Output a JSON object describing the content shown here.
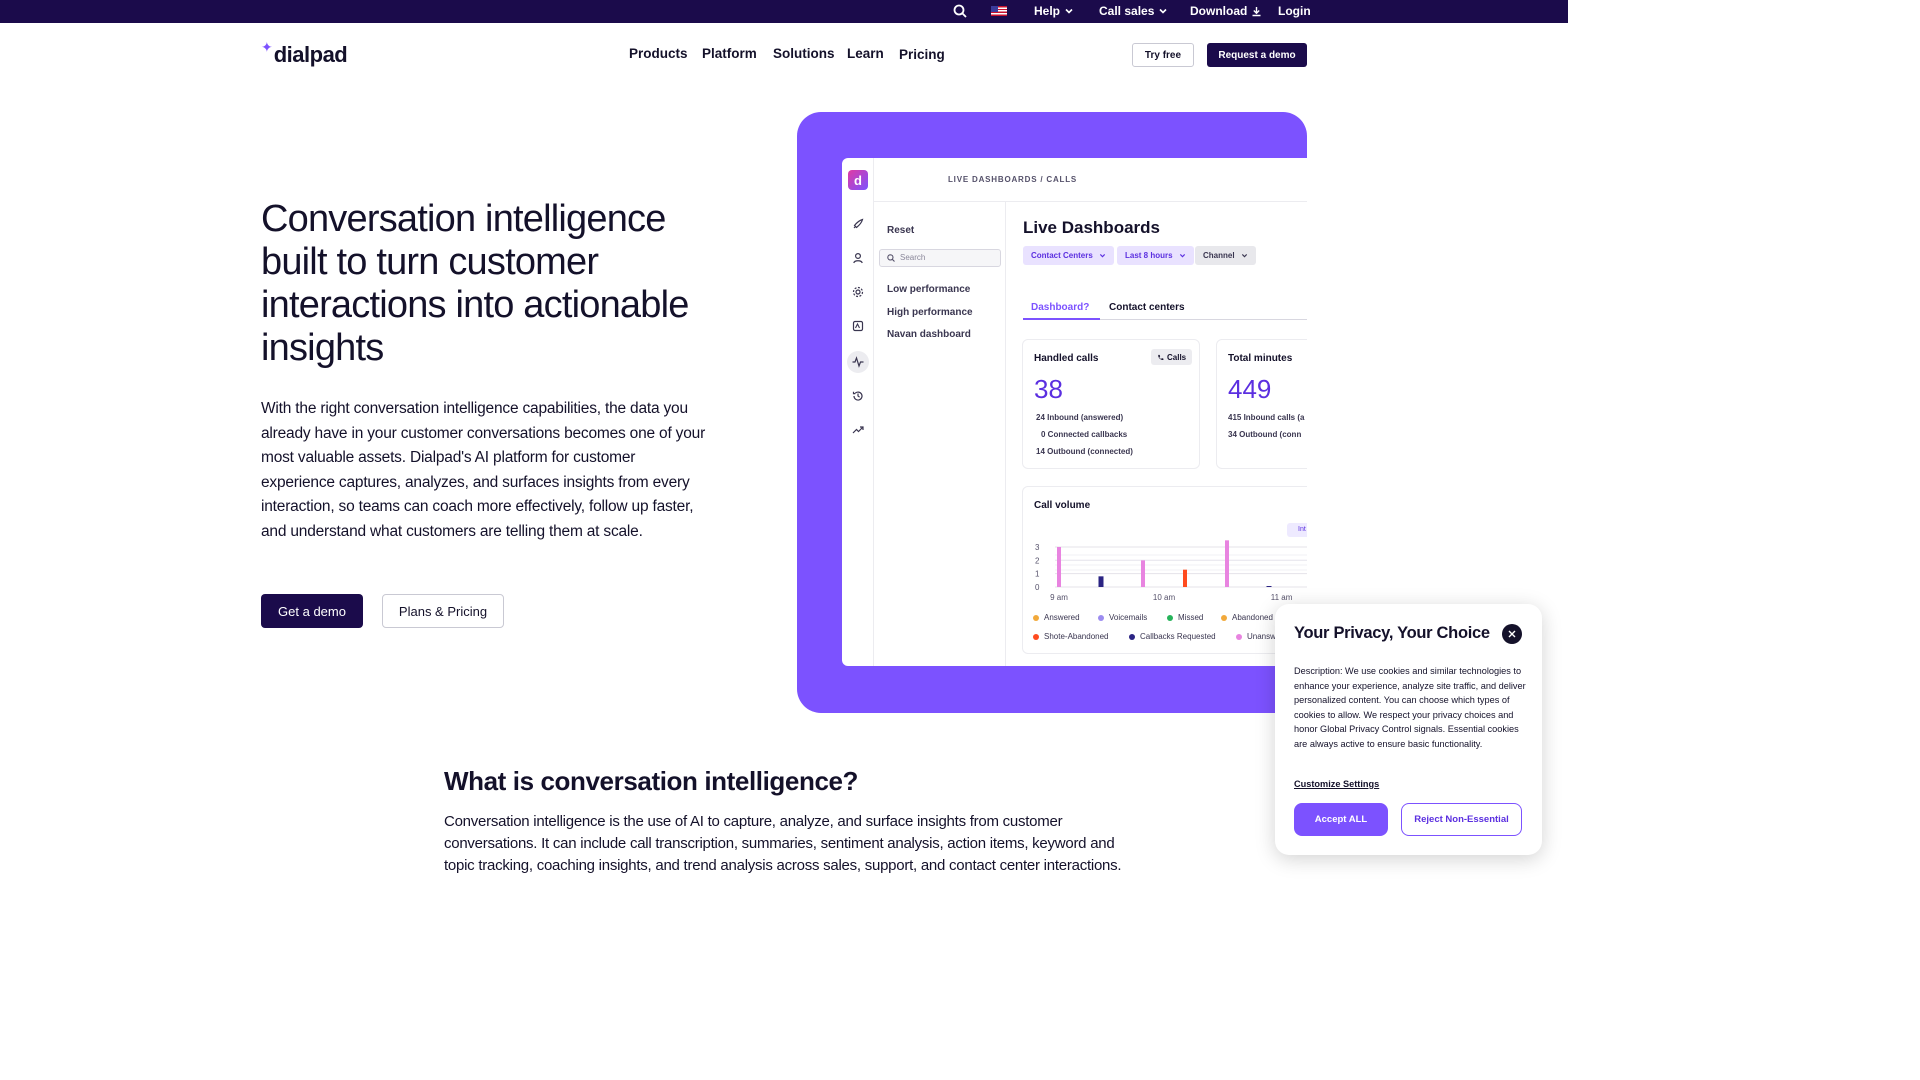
{
  "topbar": {
    "search_icon": "search-icon",
    "flag_icon": "us-flag-icon",
    "help": "Help",
    "call_sales": "Call sales",
    "download": "Download",
    "login": "Login"
  },
  "nav": {
    "logo": "dialpad",
    "items": [
      "Products",
      "Platform",
      "Solutions",
      "Learn",
      "Pricing"
    ],
    "try_free": "Try free",
    "request_demo": "Request a demo"
  },
  "hero": {
    "title": "Conversation intelligence built to turn customer interactions into actionable insights",
    "body": "With the right conversation intelligence capabilities, the data you already have in your customer conversations becomes one of your most valuable assets. Dialpad's AI platform for customer experience captures, analyzes, and surfaces insights from every interaction, so teams can coach more effectively, follow up faster, and understand what customers are telling them at scale.",
    "get_demo": "Get a demo",
    "plans_pricing": "Plans & Pricing"
  },
  "app": {
    "logo_letter": "d",
    "breadcrumb": "LIVE DASHBOARDS / CALLS",
    "panel": {
      "reset": "Reset",
      "search_placeholder": "Search",
      "items": [
        "Low performance",
        "High performance",
        "Navan dashboard"
      ]
    },
    "title": "Live Dashboards",
    "filters": [
      "Contact Centers",
      "Last 8 hours",
      "Channel"
    ],
    "tabs": [
      "Dashboard?",
      "Contact centers"
    ],
    "handled": {
      "title": "Handled calls",
      "chip": "Calls",
      "value": "38",
      "lines": [
        "24 Inbound (answered)",
        "0 Connected callbacks",
        "14 Outbound (connected)"
      ]
    },
    "minutes": {
      "title": "Total minutes",
      "value": "449",
      "lines": [
        "415 Inbound calls (a",
        "34 Outbound (conn"
      ]
    },
    "volume": {
      "title": "Call volume",
      "badge": "Int"
    }
  },
  "chart_data": {
    "type": "bar",
    "title": "Call volume",
    "x_ticks": [
      "9 am",
      "10 am",
      "11 am"
    ],
    "y_ticks": [
      "0",
      "1",
      "2",
      "3"
    ],
    "ylim": [
      0,
      3
    ],
    "bars": [
      {
        "x": 0.0,
        "value": 3.0,
        "series": "Unanswered"
      },
      {
        "x": 1.0,
        "value": 0.8,
        "series": "Callbacks Requested"
      },
      {
        "x": 2.0,
        "value": 2.0,
        "series": "Unanswered"
      },
      {
        "x": 3.0,
        "value": 1.3,
        "series": "Shote-Abandoned"
      },
      {
        "x": 4.0,
        "value": 3.5,
        "series": "Unanswered"
      },
      {
        "x": 5.0,
        "value": 0.05,
        "series": "Callbacks Requested"
      }
    ],
    "legend": [
      {
        "name": "Answered",
        "color": "#f2a93b"
      },
      {
        "name": "Voicemails",
        "color": "#9c8cf0"
      },
      {
        "name": "Missed",
        "color": "#26b35a"
      },
      {
        "name": "Abandoned",
        "color": "#f2a93b"
      },
      {
        "name": "Shote-Abandoned",
        "color": "#ff4b1f"
      },
      {
        "name": "Callbacks Requested",
        "color": "#2b2483"
      },
      {
        "name": "Unansw",
        "color": "#e884e0"
      }
    ],
    "colors": {
      "Unanswered": "#e884e0",
      "Callbacks Requested": "#2b2483",
      "Shote-Abandoned": "#ff4b1f"
    }
  },
  "what": {
    "heading": "What is conversation intelligence?",
    "body": "Conversation intelligence is the use of AI to capture, analyze, and surface insights from customer conversations. It can include call transcription, summaries, sentiment analysis, action items, keyword and topic tracking, coaching insights, and trend analysis across sales, support, and contact center interactions."
  },
  "privacy": {
    "title": "Your Privacy, Your Choice",
    "description": "Description: We use cookies and similar technologies to enhance your experience, analyze site traffic, and deliver personalized content. You can choose which types of cookies to allow. We respect your privacy choices and honor Global Privacy Control signals. Essential cookies are always active to ensure basic functionality.",
    "customize": "Customize Settings",
    "accept": "Accept ALL",
    "reject": "Reject Non-Essential"
  },
  "colors": {
    "brand_dark": "#1b0b4b",
    "brand_purple": "#7c52ff"
  }
}
